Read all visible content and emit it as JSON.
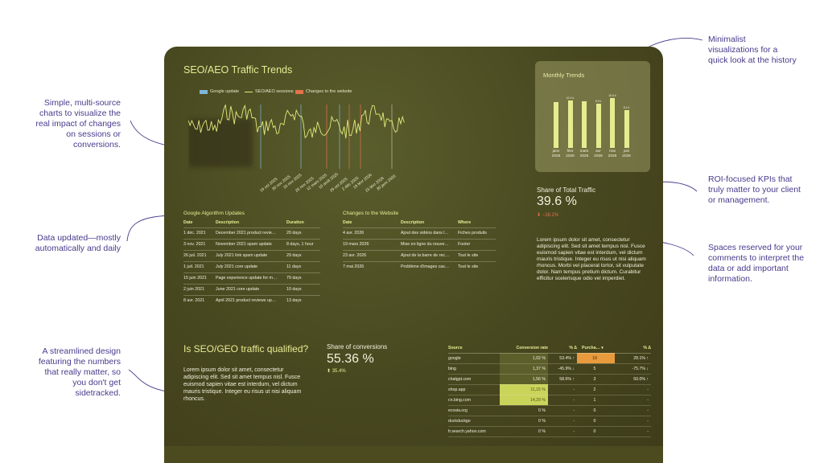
{
  "annotations": {
    "left": [
      "Simple, multi-source charts to visualize the real impact of changes on sessions or conversions.",
      "Data updated—mostly automatically and daily",
      "A streamlined design featuring the numbers that really matter, so you don't get sidetracked."
    ],
    "right": [
      "Minimalist visualizations for a quick look at the history",
      "ROI-focused KPIs that truly matter to your client or management.",
      "Spaces reserved for your comments to interpret the data or add important information."
    ]
  },
  "dashboard": {
    "traffic_title": "SEO/AEO Traffic Trends",
    "legend": [
      "Google update",
      "SEO/AEO sessions",
      "Changes to the website"
    ],
    "colors": {
      "google_update": "#7fb6d6",
      "sessions": "#e2ea7a",
      "changes": "#e2734b",
      "bar": "#e5ec8f",
      "highlight": "#c9d45a",
      "orange": "#e89a3d"
    },
    "x_labels": [
      "19 oct 2025",
      "30 nov 2025",
      "15 nov 2025",
      "26 nov 2025",
      "12 mars 2025",
      "10 août 2025",
      "29 oct 2025",
      "2 déc 2025",
      "19 févr 2026",
      "23 févr 2026",
      "30 janv 2026"
    ],
    "monthly": {
      "title": "Monthly Trends",
      "months": [
        "janv 2026",
        "févr 2026",
        "mars 2026",
        "avr 2026",
        "mai 2026",
        "juin 2026"
      ],
      "value_labels": [
        "",
        "10.1 k",
        "",
        "9.5 k",
        "10.6 k",
        "8.1 k"
      ],
      "values": [
        9.8,
        10.1,
        10.0,
        9.5,
        10.6,
        8.1
      ]
    },
    "kpi": {
      "label": "Share of Total Traffic",
      "value": "39.6 %",
      "delta": "−16.2%"
    },
    "comment": "Lorem ipsum dolor sit amet, consectetur adipiscing elit. Sed sit amet tempus nisl. Fusce euismod sapien vitae est interdum, vel dictum mauris tristique. Integer eu risus ut nisi aliquam rhoncus. Morbi vel placerat tortor, sit vulputate dolor. Nam tempus pretium dictum. Curabitur efficitur scelerisque odio vel imperdiet.",
    "google_updates": {
      "title": "Google Algorithm Updates",
      "headers": [
        "Date",
        "Description",
        "Duration"
      ],
      "rows": [
        [
          "1 déc. 2021",
          "December 2021 product revie…",
          "20 days"
        ],
        [
          "3 nov. 2021",
          "November 2021 spam update",
          "8 days, 1 hour"
        ],
        [
          "26 juil. 2021",
          "July 2021 link spam update",
          "29 days"
        ],
        [
          "1 juil. 2021",
          "July 2021 core update",
          "11 days"
        ],
        [
          "15 juin 2021",
          "Page experience update for m…",
          "79 days"
        ],
        [
          "2 juin 2021",
          "June 2021 core update",
          "10 days"
        ],
        [
          "8 avr. 2021",
          "April 2021 product reviews up…",
          "13 days"
        ]
      ]
    },
    "site_changes": {
      "title": "Changes to the Website",
      "headers": [
        "Date",
        "Description",
        "Where"
      ],
      "rows": [
        [
          "4 avr. 2026",
          "Ajout des vidéos dans l…",
          "Fiches produits"
        ],
        [
          "19 mars 2026",
          "Mise en ligne du nouve…",
          "Footer"
        ],
        [
          "23 avr. 2026",
          "Ajout de la barre de rec…",
          "Tout le site"
        ],
        [
          "7 mai 2026",
          "Problème d'images cas…",
          "Tout le site"
        ]
      ]
    },
    "qualified": {
      "title": "Is SEO/GEO traffic qualified?",
      "text": "Lorem ipsum dolor sit amet, consectetur adipiscing elit. Sed sit amet tempus nisl. Fusce euismod sapien vitae est interdum, vel dictum mauris tristique. Integer eu risus ut nisi aliquam rhoncus."
    },
    "share_conv": {
      "label": "Share of conversions",
      "value": "55.36 %",
      "delta": "35.4%"
    },
    "conversions": {
      "headers": [
        "Source",
        "Conversion rate",
        "% Δ",
        "Purcha…",
        "% Δ"
      ],
      "rows": [
        [
          "google",
          "1,02 %",
          "53.4% ↑",
          "18",
          "28.1% ↑"
        ],
        [
          "bing",
          "1,37 %",
          "-45.9% ↓",
          "5",
          "-75.7% ↓"
        ],
        [
          "chatgpt.com",
          "1,56 %",
          "58.6% ↑",
          "3",
          "50.0% ↑"
        ],
        [
          "shop.app",
          "11,15 %",
          "-",
          "2",
          "-"
        ],
        [
          "cn.bing.com",
          "14,29 %",
          "-",
          "1",
          "-"
        ],
        [
          "ecosia.org",
          "0 %",
          "-",
          "0",
          "-"
        ],
        [
          "duckduckgo",
          "0 %",
          "-",
          "0",
          "-"
        ],
        [
          "fr.search.yahoo.com",
          "0 %",
          "-",
          "0",
          "-"
        ]
      ]
    }
  }
}
